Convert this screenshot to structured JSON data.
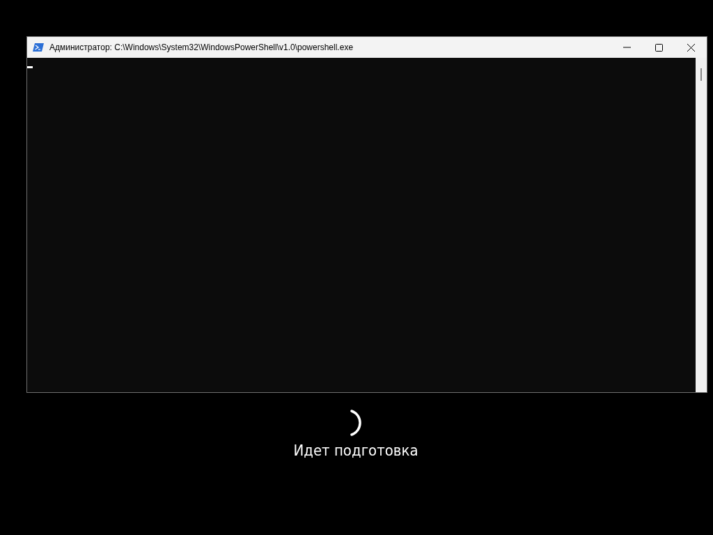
{
  "window": {
    "title": "Администратор: C:\\Windows\\System32\\WindowsPowerShell\\v1.0\\powershell.exe"
  },
  "status": {
    "message": "Идет подготовка"
  }
}
